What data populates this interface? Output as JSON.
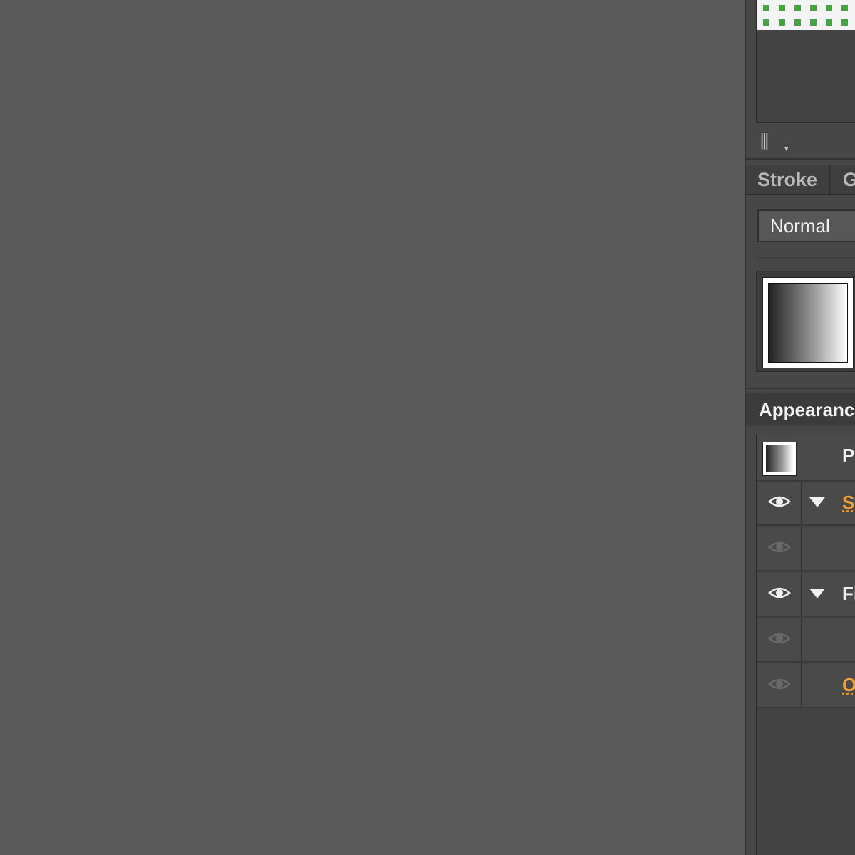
{
  "canvas": {
    "background": "#5a5a5a"
  },
  "swatches": {
    "library_icon": "swatch-library-icon",
    "swatch_color": "#3ea83a"
  },
  "tabs": [
    {
      "label": "Stroke"
    },
    {
      "label": "G"
    }
  ],
  "transparency": {
    "blend_mode": "Normal"
  },
  "appearance": {
    "title": "Appearanc",
    "object_label": "P",
    "rows": [
      {
        "label": "St",
        "style": "orange",
        "eye": "visible",
        "expandable": true
      },
      {
        "label": "",
        "style": "white",
        "eye": "dim",
        "expandable": false
      },
      {
        "label": "Fi",
        "style": "white",
        "eye": "visible",
        "expandable": true
      },
      {
        "label": "",
        "style": "white",
        "eye": "dim",
        "expandable": false
      },
      {
        "label": "O",
        "style": "orange",
        "eye": "dim",
        "expandable": false
      }
    ]
  }
}
